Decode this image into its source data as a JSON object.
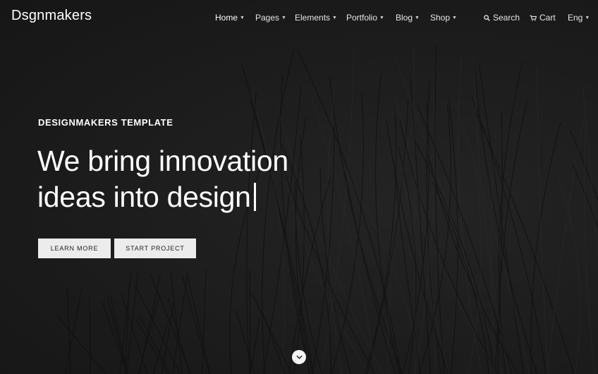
{
  "header": {
    "logo": "Dsgnmakers",
    "nav": [
      {
        "label": "Home",
        "active": true
      },
      {
        "label": "Pages",
        "active": false
      },
      {
        "label": "Elements",
        "active": false
      },
      {
        "label": "Portfolio",
        "active": false
      },
      {
        "label": "Blog",
        "active": false
      },
      {
        "label": "Shop",
        "active": false
      }
    ],
    "search_label": "Search",
    "cart_label": "Cart",
    "language_label": "Eng"
  },
  "hero": {
    "eyebrow": "DESIGNMAKERS TEMPLATE",
    "headline_line1": "We bring innovation",
    "headline_line2": "ideas into design",
    "primary_button": "LEARN MORE",
    "secondary_button": "START PROJECT"
  },
  "icons": {
    "search": "search-icon",
    "cart": "cart-icon",
    "nav_caret": "chevron-down-icon",
    "scroll": "chevron-down-icon"
  },
  "colors": {
    "background": "#1b1b1b",
    "text": "#ffffff",
    "button_bg": "#ececec",
    "button_text": "#222222"
  }
}
